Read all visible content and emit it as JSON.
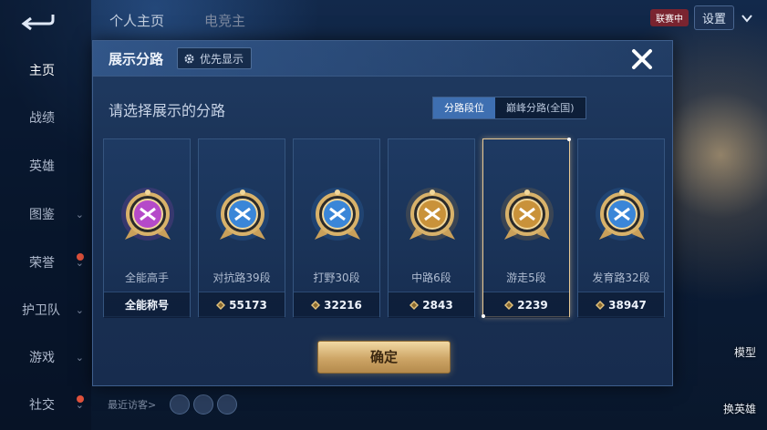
{
  "top_tabs": [
    "个人主页",
    "电竞主"
  ],
  "top_right": {
    "badge": "联赛中",
    "settings_label": "设置"
  },
  "nav": {
    "items": [
      {
        "label": "主页",
        "active": true
      },
      {
        "label": "战绩"
      },
      {
        "label": "英雄"
      },
      {
        "label": "图鉴"
      },
      {
        "label": "荣誉"
      },
      {
        "label": "护卫队"
      },
      {
        "label": "游戏"
      },
      {
        "label": "社交"
      }
    ]
  },
  "right_side": {
    "model_label": "模型",
    "switch_hero_label": "换英雄"
  },
  "bottom": {
    "recent_visitors": "最近访客>"
  },
  "modal": {
    "title": "展示分路",
    "priority_label": "优先显示",
    "subtitle": "请选择展示的分路",
    "toggle": {
      "option1": "分路段位",
      "option2": "巅峰分路(全国)"
    },
    "confirm_label": "确定",
    "cards": [
      {
        "label": "全能高手",
        "stat": "全能称号",
        "emblem": "all-round-emblem",
        "color": "#b54ac9"
      },
      {
        "label": "对抗路39段",
        "stat": "55173",
        "emblem": "clash-lane-emblem",
        "color": "#3a86d8"
      },
      {
        "label": "打野30段",
        "stat": "32216",
        "emblem": "jungle-emblem",
        "color": "#3a86d8"
      },
      {
        "label": "中路6段",
        "stat": "2843",
        "emblem": "mid-lane-emblem",
        "color": "#c9923a"
      },
      {
        "label": "游走5段",
        "stat": "2239",
        "emblem": "roam-emblem",
        "color": "#c9923a",
        "selected": true
      },
      {
        "label": "发育路32段",
        "stat": "38947",
        "emblem": "farm-lane-emblem",
        "color": "#3a86d8"
      }
    ]
  }
}
